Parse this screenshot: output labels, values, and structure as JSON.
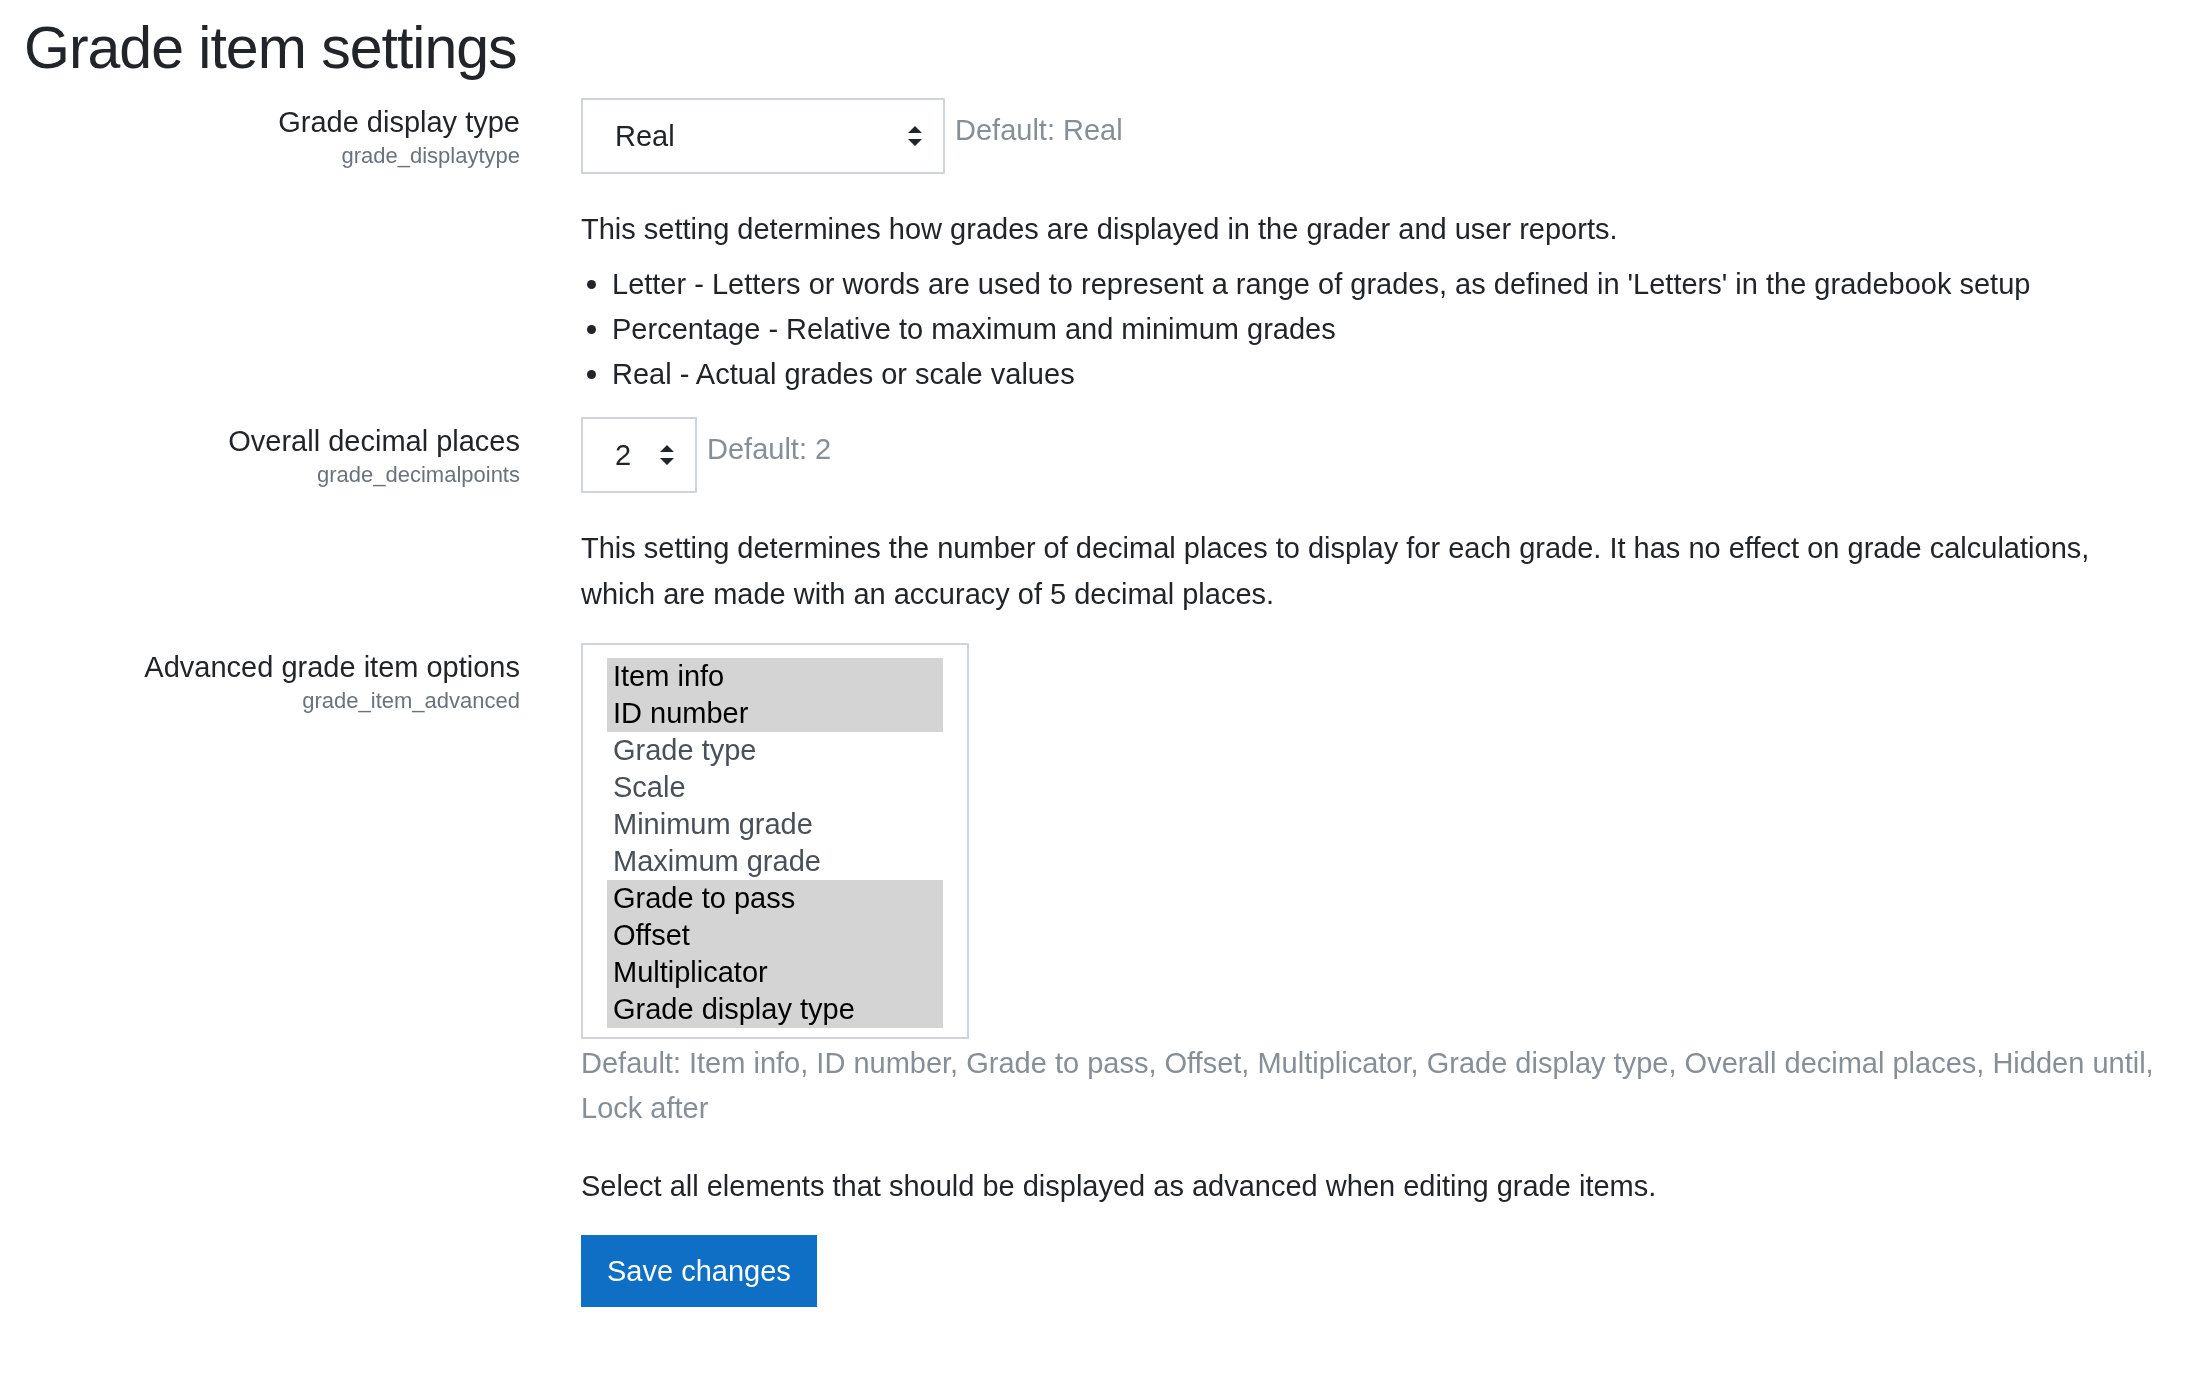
{
  "title": "Grade item settings",
  "settings": [
    {
      "kind": "select",
      "label": "Grade display type",
      "key": "grade_displaytype",
      "value": "Real",
      "default": "Default: Real",
      "description": "This setting determines how grades are displayed in the grader and user reports.",
      "bullets": [
        "Letter - Letters or words are used to represent a range of grades, as defined in 'Letters' in the gradebook setup",
        "Percentage - Relative to maximum and minimum grades",
        "Real - Actual grades or scale values"
      ]
    },
    {
      "kind": "select",
      "label": "Overall decimal places",
      "key": "grade_decimalpoints",
      "value": "2",
      "default": "Default: 2",
      "description": "This setting determines the number of decimal places to display for each grade. It has no effect on grade calculations, which are made with an accuracy of 5 decimal places."
    },
    {
      "kind": "multiselect",
      "label": "Advanced grade item options",
      "key": "grade_item_advanced",
      "options": [
        {
          "label": "Item info",
          "selected": true
        },
        {
          "label": "ID number",
          "selected": true
        },
        {
          "label": "Grade type",
          "selected": false
        },
        {
          "label": "Scale",
          "selected": false
        },
        {
          "label": "Minimum grade",
          "selected": false
        },
        {
          "label": "Maximum grade",
          "selected": false
        },
        {
          "label": "Grade to pass",
          "selected": true
        },
        {
          "label": "Offset",
          "selected": true
        },
        {
          "label": "Multiplicator",
          "selected": true
        },
        {
          "label": "Grade display type",
          "selected": true
        }
      ],
      "default": "Default: Item info, ID number, Grade to pass, Offset, Multiplicator, Grade display type, Overall decimal places, Hidden until, Lock after",
      "description": "Select all elements that should be displayed as advanced when editing grade items."
    }
  ],
  "save_button": "Save changes"
}
